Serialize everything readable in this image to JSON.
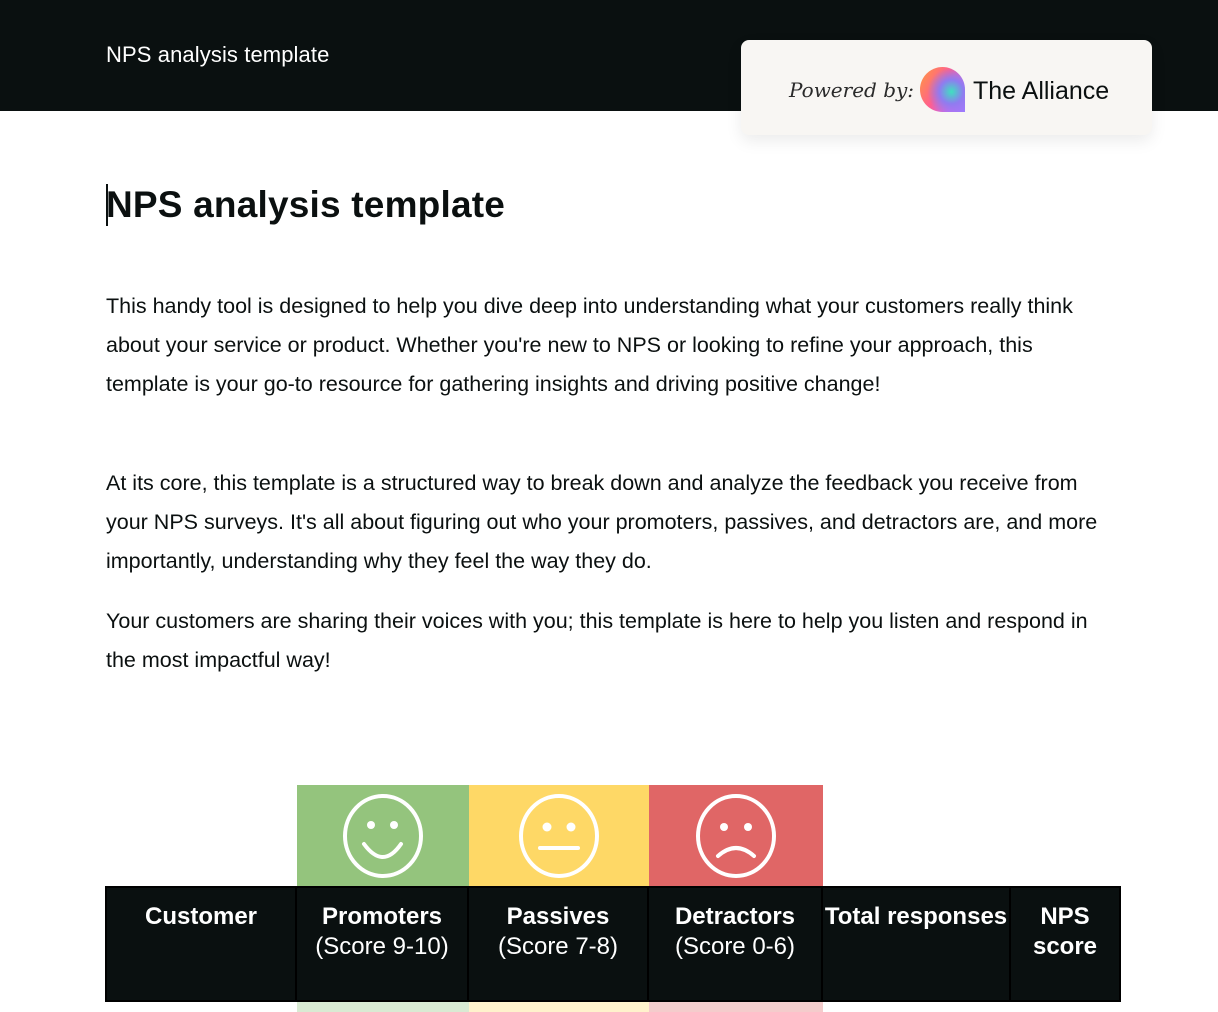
{
  "header": {
    "title": "NPS analysis template",
    "powered_by_label": "Powered by:",
    "brand_name": "The Alliance",
    "brand_logo_icon": "the-alliance-logo-icon"
  },
  "page": {
    "title": "NPS analysis template",
    "paragraphs": [
      "This handy tool is designed to help you dive deep into understanding what your customers really think about your service or product. Whether you're new to NPS or looking to refine your approach, this template is your go-to resource for gathering insights and driving positive change!",
      "At its core, this template is a structured way to break down and analyze the feedback you receive from your NPS surveys. It's all about figuring out who your promoters, passives, and detractors are, and more importantly, understanding why they feel the way they do.",
      "Your customers are sharing their voices with you; this template is here to help you listen and respond in the most impactful way!"
    ]
  },
  "table": {
    "columns": [
      {
        "title": "Customer",
        "subtitle": ""
      },
      {
        "title": "Promoters",
        "subtitle": "(Score 9-10)",
        "icon": "smiling-face-icon",
        "color": "#94c47d",
        "tint": "#d9ead3"
      },
      {
        "title": "Passives",
        "subtitle": "(Score 7-8)",
        "icon": "neutral-face-icon",
        "color": "#fed866",
        "tint": "#fff2cc"
      },
      {
        "title": "Detractors",
        "subtitle": "(Score 0-6)",
        "icon": "frowning-face-icon",
        "color": "#e06666",
        "tint": "#f4cccc"
      },
      {
        "title": "Total responses",
        "subtitle": ""
      },
      {
        "title": "NPS score",
        "subtitle": ""
      }
    ]
  },
  "colors": {
    "header_bg": "#0a1010",
    "card_bg": "#f8f6f3",
    "promoters": "#94c47d",
    "passives": "#fed866",
    "detractors": "#e06666"
  }
}
